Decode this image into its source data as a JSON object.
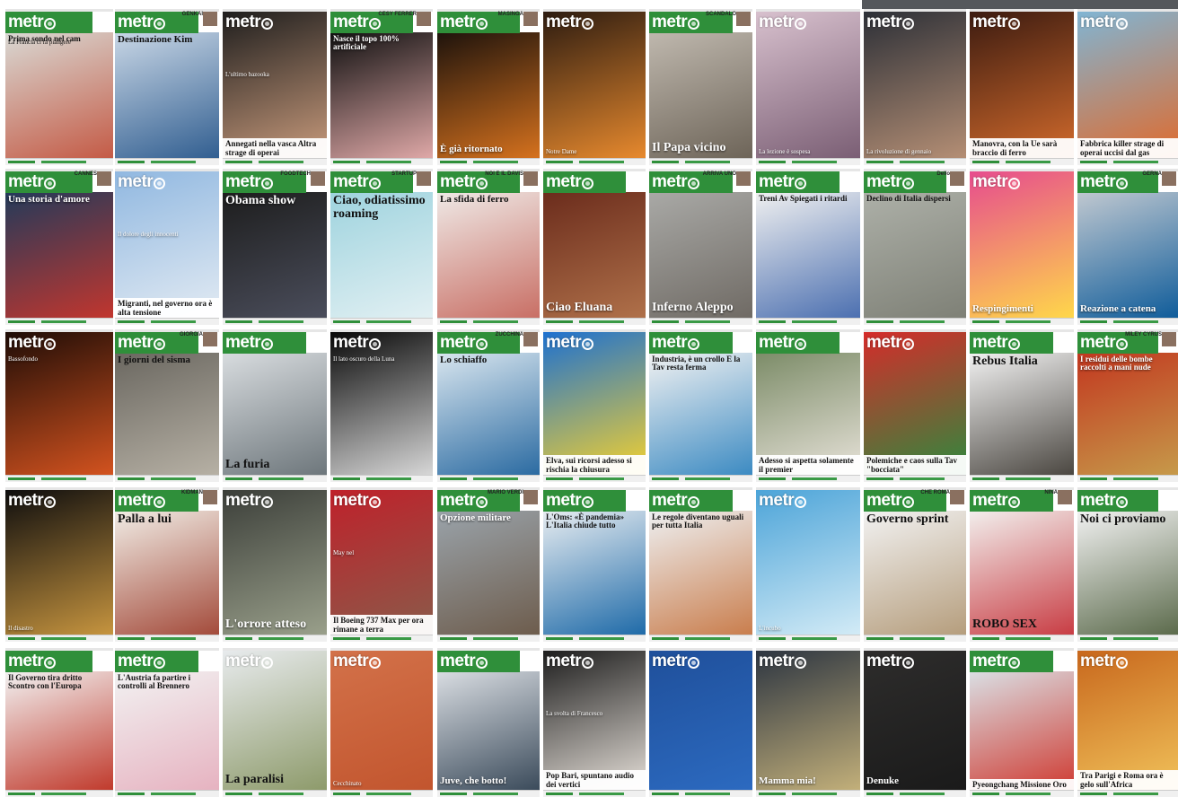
{
  "masthead": "metr",
  "covers": [
    {
      "hl": "Prima sondo nel cam",
      "hl2": "La Francia ci fa piangere",
      "kick": "",
      "style": "green",
      "bg": [
        "#d9d9d4",
        "#c45a45"
      ],
      "hlPos": "upper",
      "hlColor": "dark",
      "hlSize": "sml"
    },
    {
      "hl": "Destinazione Kim",
      "kick": "GENKAI",
      "style": "green",
      "bg": [
        "#c9d7e6",
        "#315e90"
      ],
      "hlPos": "upper",
      "hlColor": "dark",
      "hlSize": "med"
    },
    {
      "hl": "Annegati nella vasca Altra strage di operai",
      "hl2": "L'ultimo bazooka",
      "kick": "",
      "style": "clear",
      "bg": [
        "#1c1c1c",
        "#c99b7c"
      ],
      "hlPos": "lower",
      "hlColor": "dark",
      "hlSize": "sml",
      "footWhite": true
    },
    {
      "hl": "Nasce il topo 100% artificiale",
      "kick": "CESY FERRER",
      "style": "green",
      "bg": [
        "#101010",
        "#e0a9a8"
      ],
      "hlPos": "upper",
      "hlColor": "light",
      "hlSize": "sml"
    },
    {
      "hl": "È già ritornato",
      "kick": "MASINGA",
      "style": "green",
      "bg": [
        "#1e130c",
        "#d6721e"
      ],
      "hlPos": "lower",
      "hlColor": "light",
      "hlSize": "med"
    },
    {
      "hl": "Notre Dame",
      "kick": "",
      "style": "clear",
      "bg": [
        "#2a1a10",
        "#e88a2e"
      ],
      "hlPos": "lower",
      "hlColor": "light",
      "hlSize": "fine"
    },
    {
      "hl": "Il Papa vicino",
      "kick": "SCANDALO",
      "style": "green",
      "bg": [
        "#bfb8ae",
        "#6d6458"
      ],
      "hlPos": "lower",
      "hlColor": "light",
      "hlSize": "big"
    },
    {
      "hl": "La lezione è sospesa",
      "kick": "",
      "style": "clear",
      "bg": [
        "#d9c2cf",
        "#7a5e74"
      ],
      "hlPos": "lower",
      "hlColor": "light",
      "hlSize": "fine"
    },
    {
      "hl": "La rivoluzione di gennaio",
      "kick": "",
      "style": "clear",
      "bg": [
        "#2a2e36",
        "#b58f75"
      ],
      "hlPos": "lower",
      "hlColor": "light",
      "hlSize": "fine"
    },
    {
      "hl": "Manovra, con la Ue sarà braccio di ferro",
      "kick": "",
      "style": "clear",
      "bg": [
        "#3a1a10",
        "#d36b2c"
      ],
      "hlPos": "lower",
      "hlColor": "dark",
      "hlSize": "sml",
      "footWhite": true
    },
    {
      "hl": "Fabbrica killer strage di operai uccisi dal gas",
      "kick": "",
      "style": "clear",
      "bg": [
        "#7fb6d6",
        "#e06a2c"
      ],
      "hlPos": "lower",
      "hlColor": "dark",
      "hlSize": "sml",
      "footWhite": true
    },
    {
      "hl": "Una storia d'amore",
      "kick": "CANNES",
      "style": "green",
      "bg": [
        "#233a5a",
        "#c2362e"
      ],
      "hlPos": "upper",
      "hlColor": "light",
      "hlSize": "med"
    },
    {
      "hl": "Migranti, nel governo ora è alta tensione",
      "hl2": "Il dolore degli innocenti",
      "kick": "",
      "style": "clear",
      "bg": [
        "#8fb7e0",
        "#e3ebf3"
      ],
      "hlPos": "lower",
      "hlColor": "dark",
      "hlSize": "sml",
      "footWhite": true
    },
    {
      "hl": "Obama show",
      "kick": "FOODTECH",
      "style": "green",
      "bg": [
        "#1d1d1d",
        "#4b4e5c"
      ],
      "hlPos": "upper",
      "hlColor": "light",
      "hlSize": "big"
    },
    {
      "hl": "Ciao, odiatissimo roaming",
      "kick": "STARTUP",
      "style": "green",
      "bg": [
        "#9ed3de",
        "#e2f0f3"
      ],
      "hlPos": "upper",
      "hlColor": "dark",
      "hlSize": "big"
    },
    {
      "hl": "La sfida di ferro",
      "kick": "NOI E IL DAVIS",
      "style": "green",
      "bg": [
        "#efe9e6",
        "#c86e64"
      ],
      "hlPos": "upper",
      "hlColor": "dark",
      "hlSize": "med"
    },
    {
      "hl": "Ciao Eluana",
      "kick": "",
      "style": "green",
      "bg": [
        "#6b2c1c",
        "#b0714a"
      ],
      "hlPos": "lower",
      "hlColor": "light",
      "hlSize": "big"
    },
    {
      "hl": "Inferno Aleppo",
      "kick": "ARRIVA UNO",
      "style": "green",
      "bg": [
        "#a9a9a6",
        "#6f6a64"
      ],
      "hlPos": "lower",
      "hlColor": "light",
      "hlSize": "big"
    },
    {
      "hl": "Treni Av Spiegati i ritardi",
      "kick": "",
      "style": "green",
      "bg": [
        "#f0f0f0",
        "#4b6fb0"
      ],
      "hlPos": "upper",
      "hlColor": "dark",
      "hlSize": "sml"
    },
    {
      "hl": "Declino di Italia dispersi",
      "kick": "Dello",
      "style": "green",
      "bg": [
        "#adb0a8",
        "#7e8076"
      ],
      "hlPos": "upper",
      "hlColor": "dark",
      "hlSize": "sml"
    },
    {
      "hl": "Respingimenti",
      "kick": "",
      "style": "clear",
      "bg": [
        "#e64a8f",
        "#ffd84a"
      ],
      "hlPos": "lower",
      "hlColor": "light",
      "hlSize": "med"
    },
    {
      "hl": "Reazione a catena",
      "kick": "GERNA",
      "style": "green",
      "bg": [
        "#c0c8d0",
        "#0f5c9a"
      ],
      "hlPos": "lower",
      "hlColor": "light",
      "hlSize": "med"
    },
    {
      "hl": "Bassofondo",
      "kick": "",
      "style": "clear",
      "bg": [
        "#1b0b06",
        "#d4531f"
      ],
      "hlPos": "upper",
      "hlColor": "light",
      "hlSize": "fine"
    },
    {
      "hl": "I giorni del sisma",
      "kick": "GIORGIA",
      "style": "green",
      "bg": [
        "#6a6760",
        "#b7b1a5"
      ],
      "hlPos": "upper",
      "hlColor": "dark",
      "hlSize": "med"
    },
    {
      "hl": "La furia",
      "kick": "",
      "style": "green",
      "bg": [
        "#d8dcdf",
        "#6d767b"
      ],
      "hlPos": "lower",
      "hlColor": "dark",
      "hlSize": "big"
    },
    {
      "hl": "Il lato oscuro della Luna",
      "kick": "",
      "style": "clear",
      "bg": [
        "#050505",
        "#d8d8d8"
      ],
      "hlPos": "upper",
      "hlColor": "light",
      "hlSize": "fine"
    },
    {
      "hl": "Lo schiaffo",
      "kick": "ZUCCHINA",
      "style": "green",
      "bg": [
        "#d9e6ef",
        "#2a6aa1"
      ],
      "hlPos": "upper",
      "hlColor": "dark",
      "hlSize": "med"
    },
    {
      "hl": "Elva, sui ricorsi adesso si rischia la chiusura",
      "kick": "",
      "style": "clear",
      "bg": [
        "#1a6fd2",
        "#f5d22e"
      ],
      "hlPos": "lower",
      "hlColor": "dark",
      "hlSize": "sml",
      "footWhite": true
    },
    {
      "hl": "Industria, è un crollo E la Tav resta ferma",
      "kick": "",
      "style": "green",
      "bg": [
        "#f2f2f2",
        "#3b8ac2"
      ],
      "hlPos": "upper",
      "hlColor": "dark",
      "hlSize": "sml"
    },
    {
      "hl": "Adesso si aspetta solamente il premier",
      "kick": "",
      "style": "green",
      "bg": [
        "#7c8c68",
        "#e8e3da"
      ],
      "hlPos": "lower",
      "hlColor": "dark",
      "hlSize": "sml",
      "footWhite": true
    },
    {
      "hl": "Polemiche e caos sulla Tav \"bocciata\"",
      "kick": "",
      "style": "clear",
      "bg": [
        "#d72a2a",
        "#2e8a3e"
      ],
      "hlPos": "lower",
      "hlColor": "dark",
      "hlSize": "sml",
      "footWhite": true
    },
    {
      "hl": "Rebus Italia",
      "kick": "",
      "style": "green",
      "bg": [
        "#f2f2f2",
        "#4a4640"
      ],
      "hlPos": "upper",
      "hlColor": "dark",
      "hlSize": "big"
    },
    {
      "hl": "I residui delle bombe raccolti a mani nude",
      "kick": "MILEY CYRUS",
      "style": "green",
      "bg": [
        "#c2371f",
        "#c69a4a"
      ],
      "hlPos": "upper",
      "hlColor": "light",
      "hlSize": "sml"
    },
    {
      "hl": "Il disastro",
      "kick": "",
      "style": "clear",
      "bg": [
        "#0b0b0d",
        "#c7953f"
      ],
      "hlPos": "lower",
      "hlColor": "light",
      "hlSize": "fine"
    },
    {
      "hl": "Palla a lui",
      "kick": "KIDMAN",
      "style": "green",
      "bg": [
        "#f1ede6",
        "#a34a3a"
      ],
      "hlPos": "upper",
      "hlColor": "dark",
      "hlSize": "big"
    },
    {
      "hl": "L'orrore atteso",
      "kick": "",
      "style": "clear",
      "bg": [
        "#3a3d38",
        "#9aa08b"
      ],
      "hlPos": "lower",
      "hlColor": "light",
      "hlSize": "big"
    },
    {
      "hl": "Il Boeing 737 Max per ora rimane a terra",
      "hl2": "May nel",
      "kick": "",
      "style": "clear",
      "bg": [
        "#c0202a",
        "#8a5b4a"
      ],
      "hlPos": "lower",
      "hlColor": "dark",
      "hlSize": "sml",
      "footWhite": true
    },
    {
      "hl": "Opzione militare",
      "kick": "MARIO VERDI",
      "style": "green",
      "bg": [
        "#9aa3aa",
        "#6d5c4c"
      ],
      "hlPos": "upper",
      "hlColor": "light",
      "hlSize": "med"
    },
    {
      "hl": "L'Oms: «È pandemia» L'Italia chiude tutto",
      "kick": "",
      "style": "green",
      "bg": [
        "#e8edf1",
        "#1e6aa8"
      ],
      "hlPos": "upper",
      "hlColor": "dark",
      "hlSize": "sml"
    },
    {
      "hl": "Le regole diventano uguali per tutta Italia",
      "kick": "",
      "style": "green",
      "bg": [
        "#eef0f2",
        "#c97d4c"
      ],
      "hlPos": "upper",
      "hlColor": "dark",
      "hlSize": "sml"
    },
    {
      "hl": "L'incubo",
      "kick": "",
      "style": "clear",
      "bg": [
        "#4aa3d8",
        "#d3ebf6"
      ],
      "hlPos": "lower",
      "hlColor": "light",
      "hlSize": "fine"
    },
    {
      "hl": "Governo sprint",
      "kick": "CHE ROMA",
      "style": "green",
      "bg": [
        "#f2f2f2",
        "#b59d7c"
      ],
      "hlPos": "upper",
      "hlColor": "dark",
      "hlSize": "big"
    },
    {
      "hl": "ROBO SEX",
      "kick": "NINA",
      "style": "green",
      "bg": [
        "#f2efed",
        "#c83c43"
      ],
      "hlPos": "lower",
      "hlColor": "dark",
      "hlSize": "big"
    },
    {
      "hl": "Noi ci proviamo",
      "kick": "",
      "style": "green",
      "bg": [
        "#f2f2f2",
        "#5b6a4b"
      ],
      "hlPos": "upper",
      "hlColor": "dark",
      "hlSize": "big"
    },
    {
      "hl": "Il Governo tira dritto Scontro con l'Europa",
      "kick": "",
      "style": "green",
      "bg": [
        "#f2f2f2",
        "#c0392b"
      ],
      "hlPos": "upper",
      "hlColor": "dark",
      "hlSize": "sml"
    },
    {
      "hl": "L'Austria fa partire i controlli al Brennero",
      "kick": "",
      "style": "green",
      "bg": [
        "#f2f2f2",
        "#e6b2c0"
      ],
      "hlPos": "upper",
      "hlColor": "dark",
      "hlSize": "sml"
    },
    {
      "hl": "La paralisi",
      "kick": "",
      "style": "clear",
      "bg": [
        "#e9ecef",
        "#8d9a6a"
      ],
      "hlPos": "lower",
      "hlColor": "dark",
      "hlSize": "big"
    },
    {
      "hl": "Cecchinato",
      "kick": "",
      "style": "clear",
      "bg": [
        "#d3724a",
        "#c2552e"
      ],
      "hlPos": "lower",
      "hlColor": "light",
      "hlSize": "fine"
    },
    {
      "hl": "Juve, che botto!",
      "kick": "",
      "style": "green",
      "bg": [
        "#d9dde2",
        "#3a4a5a"
      ],
      "hlPos": "lower",
      "hlColor": "light",
      "hlSize": "med"
    },
    {
      "hl": "Pop Bari, spuntano audio dei vertici",
      "hl2": "La svolta di Francesco",
      "kick": "",
      "style": "clear",
      "bg": [
        "#1a1a1a",
        "#e6e0d9"
      ],
      "hlPos": "lower",
      "hlColor": "dark",
      "hlSize": "sml",
      "footWhite": true
    },
    {
      "hl": "",
      "kick": "",
      "style": "clear",
      "bg": [
        "#1f4f9a",
        "#2c6ac0"
      ],
      "hlPos": "lower",
      "hlColor": "light",
      "hlSize": "fine"
    },
    {
      "hl": "Mamma mia!",
      "kick": "",
      "style": "clear",
      "bg": [
        "#2a3340",
        "#c3b07a"
      ],
      "hlPos": "lower",
      "hlColor": "light",
      "hlSize": "med"
    },
    {
      "hl": "Denuke",
      "kick": "",
      "style": "clear",
      "bg": [
        "#2e2d2c",
        "#1a1a1a"
      ],
      "hlPos": "lower",
      "hlColor": "light",
      "hlSize": "med"
    },
    {
      "hl": "Pyeongchang Missione Oro",
      "kick": "",
      "style": "green",
      "bg": [
        "#dadfe4",
        "#cf3a31"
      ],
      "hlPos": "lower",
      "hlColor": "dark",
      "hlSize": "sml",
      "footWhite": true
    },
    {
      "hl": "Tra Parigi e Roma ora è gelo sull'Africa",
      "kick": "",
      "style": "clear",
      "bg": [
        "#c7661c",
        "#f1c25a"
      ],
      "hlPos": "lower",
      "hlColor": "dark",
      "hlSize": "sml",
      "footWhite": true
    }
  ]
}
